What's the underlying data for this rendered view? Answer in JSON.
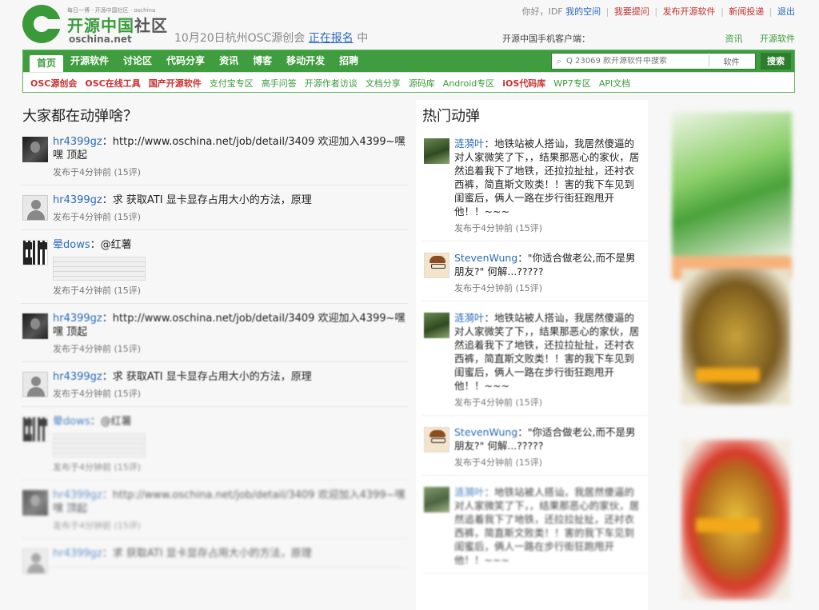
{
  "header": {
    "logo_slogan": "每日一博 · 开源中国社区 · oschina",
    "logo_cn_main": "开源中国",
    "logo_cn_tail": "社区",
    "logo_en": "oschina.net",
    "event_text": "10月20日杭州OSC源创会",
    "event_link": "正在报名",
    "event_tail": "中",
    "greeting": "你好，",
    "username": "IDF",
    "links": {
      "my_space": "我的空间",
      "my_messages": "我要提问",
      "publish_software": "发布开源软件",
      "news_submit": "新闻投递",
      "logout": "退出"
    },
    "mobile_label": "开源中国手机客户端：",
    "mobile_links": [
      "资讯",
      "开源软件"
    ]
  },
  "nav": {
    "main_tabs": [
      "首页",
      "开源软件",
      "讨论区",
      "代码分享",
      "资讯",
      "博客",
      "移动开发",
      "招聘"
    ],
    "search": {
      "placeholder": "Q 23069 款开源软件中搜索",
      "scope": "软件",
      "button": "搜索"
    },
    "sub_links": [
      {
        "label": "OSC源创会",
        "style": "red"
      },
      {
        "label": "OSC在线工具",
        "style": "red"
      },
      {
        "label": "国产开源软件",
        "style": "red"
      },
      {
        "label": "支付宝专区",
        "style": "green"
      },
      {
        "label": "高手问答",
        "style": "green"
      },
      {
        "label": "开源作者访谈",
        "style": "green"
      },
      {
        "label": "文档分享",
        "style": "green"
      },
      {
        "label": "源码库",
        "style": "green"
      },
      {
        "label": "Android专区",
        "style": "green"
      },
      {
        "label": "iOS代码库",
        "style": "red"
      },
      {
        "label": "WP7专区",
        "style": "green"
      },
      {
        "label": "API文档",
        "style": "green"
      }
    ]
  },
  "left": {
    "title": "大家都在动弹啥？",
    "items": [
      {
        "user": "hr4399gz",
        "sep": "：",
        "text": "http://www.oschina.net/job/detail/3409 欢迎加入4399~嘿嘿 顶起",
        "meta": "发布于4分钟前 (15评)",
        "avatar": "photo",
        "thumb": false
      },
      {
        "user": "hr4399gz",
        "sep": "：",
        "text": "求 获取ATI 显卡显存占用大小的方法，原理",
        "meta": "发布于4分钟前 (15评)",
        "avatar": "default",
        "thumb": false
      },
      {
        "user": "晕dows",
        "sep": "：",
        "text": "@红薯",
        "meta": "发布于4分钟前 (15评)",
        "avatar": "qr",
        "thumb": true
      },
      {
        "user": "hr4399gz",
        "sep": "：",
        "text": "http://www.oschina.net/job/detail/3409 欢迎加入4399~嘿嘿 顶起",
        "meta": "发布于4分钟前 (15评)",
        "avatar": "photo",
        "thumb": false
      },
      {
        "user": "hr4399gz",
        "sep": "：",
        "text": "求 获取ATI 显卡显存占用大小的方法，原理",
        "meta": "发布于4分钟前 (15评)",
        "avatar": "default",
        "thumb": false
      },
      {
        "user": "晕dows",
        "sep": "：",
        "text": "@红薯",
        "meta": "发布于4分钟前 (15评)",
        "avatar": "qr",
        "thumb": true
      },
      {
        "user": "hr4399gz",
        "sep": "：",
        "text": "http://www.oschina.net/job/detail/3409 欢迎加入4399~嘿嘿 顶起",
        "meta": "发布于4分钟前 (15评)",
        "avatar": "photo",
        "thumb": false
      },
      {
        "user": "hr4399gz",
        "sep": "：",
        "text": "求 获取ATI 显卡显存占用大小的方法，原理",
        "meta": "",
        "avatar": "default",
        "thumb": false
      }
    ]
  },
  "middle": {
    "title": "热门动弹",
    "items": [
      {
        "user": "涟漪叶",
        "sep": "：",
        "text": "地铁站被人搭讪，我居然傻逼的对人家微笑了下，，结果那恶心的家伙，居然追着我下了地铁，还拉拉扯扯，还衬衣西裤，简直斯文败类！！害的我下车见到闺蜜后，俩人一路在步行街狂跑甩开他！！~~~",
        "meta": "发布于4分钟前 (15评)",
        "avatar": "nature"
      },
      {
        "user": "StevenWung",
        "sep": "：",
        "text": "\"你适合做老公,而不是男朋友?\" 何解...?????",
        "meta": "发布于4分钟前 (15评)",
        "avatar": "cartoon"
      },
      {
        "user": "涟漪叶",
        "sep": "：",
        "text": "地铁站被人搭讪，我居然傻逼的对人家微笑了下，，结果那恶心的家伙，居然追着我下了地铁，还拉拉扯扯，还衬衣西裤，简直斯文败类！！害的我下车见到闺蜜后，俩人一路在步行街狂跑甩开他！！~~~",
        "meta": "发布于4分钟前 (15评)",
        "avatar": "nature"
      },
      {
        "user": "StevenWung",
        "sep": "：",
        "text": "\"你适合做老公,而不是男朋友?\" 何解...?????",
        "meta": "发布于4分钟前 (15评)",
        "avatar": "cartoon"
      },
      {
        "user": "涟漪叶",
        "sep": "：",
        "text": "地铁站被人搭讪，我居然傻逼的对人家微笑了下，，结果那恶心的家伙，居然追着我下了地铁，还拉拉扯扯，还衬衣西裤，简直斯文败类！！害的我下车见到闺蜜后，俩人一路在步行街狂跑甩开他！！~~~",
        "meta": "",
        "avatar": "nature"
      }
    ]
  },
  "colors": {
    "brand_green": "#3f9d3f",
    "link_blue": "#2a6ab8",
    "accent_red": "#c83030"
  }
}
